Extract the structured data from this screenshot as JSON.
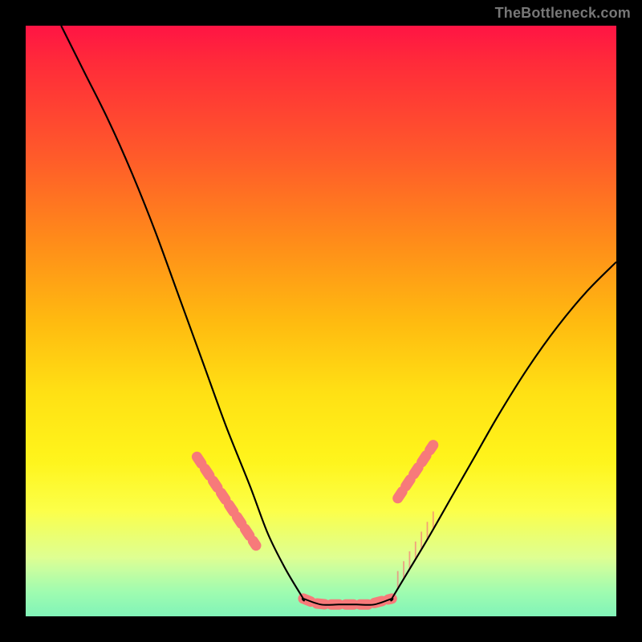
{
  "watermark": "TheBottleneck.com",
  "chart_data": {
    "type": "line",
    "title": "",
    "xlabel": "",
    "ylabel": "",
    "xlim": [
      0,
      100
    ],
    "ylim": [
      0,
      100
    ],
    "grid": false,
    "legend": false,
    "left_curve": {
      "name": "descending",
      "x": [
        6,
        10,
        14,
        18,
        22,
        26,
        30,
        34,
        38,
        41,
        44,
        47
      ],
      "y": [
        100,
        92,
        84,
        75,
        65,
        54,
        43,
        32,
        22,
        14,
        8,
        3
      ]
    },
    "right_curve": {
      "name": "ascending",
      "x": [
        62,
        65,
        68,
        72,
        76,
        80,
        85,
        90,
        95,
        100
      ],
      "y": [
        3,
        8,
        13,
        20,
        27,
        34,
        42,
        49,
        55,
        60
      ]
    },
    "trough": {
      "x": [
        47,
        50,
        53,
        56,
        59,
        62
      ],
      "y": [
        3,
        2,
        2,
        2,
        2,
        3
      ]
    },
    "salmon_dots_left": {
      "x": [
        29,
        31,
        33,
        35,
        37,
        39
      ],
      "y": [
        27,
        24,
        21,
        18,
        15,
        12
      ]
    },
    "salmon_dots_trough": {
      "x": [
        47,
        49,
        51,
        53,
        55,
        56,
        58,
        60,
        62
      ],
      "y": [
        3,
        2.2,
        2,
        2,
        2,
        2,
        2,
        2.5,
        3
      ]
    },
    "salmon_dots_right": {
      "x": [
        63,
        65,
        67,
        69
      ],
      "y": [
        20,
        23,
        26,
        29
      ]
    },
    "feather_ticks": {
      "x": [
        63,
        64,
        65,
        66,
        67,
        68,
        69
      ],
      "length": 3
    }
  }
}
